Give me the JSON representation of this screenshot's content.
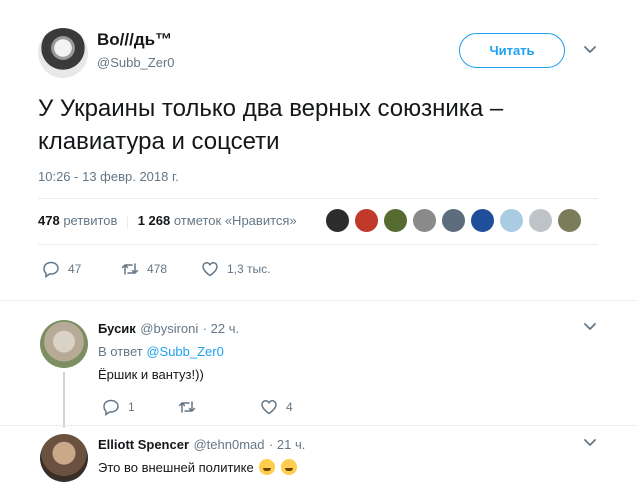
{
  "tweet": {
    "display_name": "Во///дь™",
    "handle": "@Subb_Zer0",
    "follow_label": "Читать",
    "text": "У Украины только два верных союзника – клавиатура и соцсети",
    "timestamp": "10:26 - 13 февр. 2018 г.",
    "retweets_count": "478",
    "retweets_label": "ретвитов",
    "likes_count": "1 268",
    "likes_label": "отметок «Нравится»",
    "actions": {
      "reply_count": "47",
      "retweet_count": "478",
      "like_count": "1,3 тыс."
    },
    "icons": {
      "reply": "reply-icon",
      "retweet": "retweet-icon",
      "like": "heart-icon",
      "caret": "chevron-down-icon"
    }
  },
  "replies": [
    {
      "display_name": "Бусик",
      "handle": "@bysironi",
      "time": "· 22 ч.",
      "reply_prefix": "В ответ",
      "reply_to": "@Subb_Zer0",
      "text": "Ёршик и вантуз!))",
      "reply_count": "1",
      "retweet_count": "",
      "like_count": "4"
    },
    {
      "display_name": "Elliott Spencer",
      "handle": "@tehn0mad",
      "time": "· 21 ч.",
      "text": "Это во внешней политике"
    }
  ],
  "colors": {
    "accent": "#1da1f2",
    "muted": "#657786",
    "text": "#14171a",
    "divider": "#e6ecf0"
  }
}
